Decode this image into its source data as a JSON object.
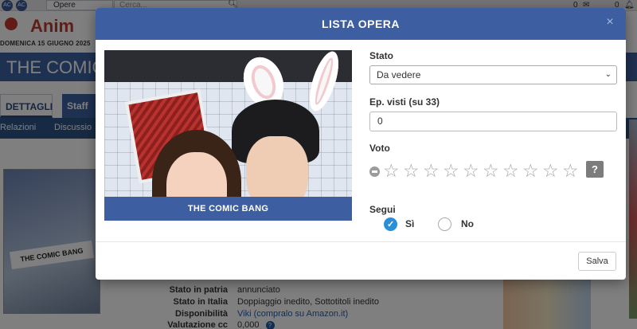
{
  "background": {
    "topbar": {
      "select_value": "Opere",
      "search_placeholder": "Cerca...",
      "messages_count": "0",
      "notifications_count": "0",
      "icon1": "AC",
      "icon2": "AC"
    },
    "logo_text": "Anim",
    "date": "DOMENICA 15 GIUGNO 2025",
    "page_title": "THE COMIC",
    "tabs": [
      "DETTAGLI",
      "Staff"
    ],
    "subtabs": [
      "Relazioni",
      "Discussio"
    ],
    "info": [
      {
        "key": "Stato in patria",
        "value": "annunciato"
      },
      {
        "key": "Stato in Italia",
        "value": "Doppiaggio inedito, Sottotitoli inedito"
      },
      {
        "key": "Disponibilità",
        "value": "Viki (compralo su Amazon.it)"
      },
      {
        "key": "Valutazione cc",
        "value": "0,000"
      }
    ],
    "poster_text": "THE COMIC BANG"
  },
  "modal": {
    "title": "LISTA OPERA",
    "close_label": "×",
    "cover_banner": "THE COMIC BANG",
    "stato_label": "Stato",
    "stato_value": "Da vedere",
    "episodes_label": "Ep. visti (su 33)",
    "episodes_value": "0",
    "voto_label": "Voto",
    "stars_count": 10,
    "voto_help": "?",
    "segui_label": "Segui",
    "segui_yes": "Sì",
    "segui_no": "No",
    "segui_selected": "Sì",
    "save_label": "Salva"
  },
  "colors": {
    "header": "#3d5fa1",
    "radio_checked": "#2b8fd8",
    "star": "#a6a6a6"
  }
}
